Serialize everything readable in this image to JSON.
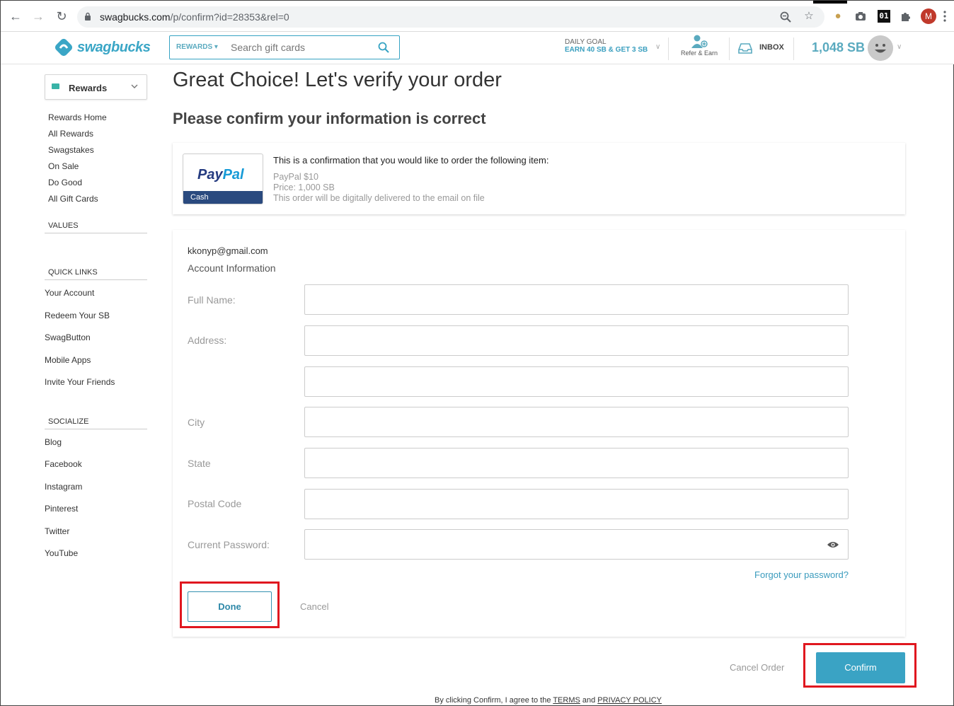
{
  "browser": {
    "url_host": "swagbucks.com",
    "url_path": "/p/confirm?id=28353&rel=0",
    "profile_initial": "M",
    "ext_label": "01",
    "icons": [
      "back-icon",
      "forward-icon",
      "reload-icon",
      "lock-icon",
      "zoom-icon",
      "star-icon",
      "cookie-icon",
      "camera-icon",
      "puzzle-icon",
      "more-icon"
    ]
  },
  "header": {
    "logo_text": "swagbucks",
    "search_category": "REWARDS",
    "search_placeholder": "Search gift cards",
    "daily_goal_title": "DAILY GOAL",
    "daily_goal_detail": "EARN 40 SB & GET 3 SB",
    "refer_label": "Refer & Earn",
    "inbox_label": "INBOX",
    "balance": "1,048 SB",
    "accent_color": "#3aa6c6"
  },
  "sidebar": {
    "select_label": "Rewards",
    "rewards_links": [
      "Rewards Home",
      "All Rewards",
      "Swagstakes",
      "On Sale",
      "Do Good",
      "All Gift Cards"
    ],
    "values_title": "VALUES",
    "quick_links_title": "QUICK LINKS",
    "quick_links": [
      "Your Account",
      "Redeem Your SB",
      "SwagButton",
      "Mobile Apps",
      "Invite Your Friends"
    ],
    "socialize_title": "SOCIALIZE",
    "social_links": [
      "Blog",
      "Facebook",
      "Instagram",
      "Pinterest",
      "Twitter",
      "YouTube"
    ]
  },
  "main": {
    "title": "Great Choice! Let's verify your order",
    "subtitle": "Please confirm your information is correct",
    "item": {
      "intro": "This is a confirmation that you would like to order the following item:",
      "name": "PayPal $10",
      "price": "Price: 1,000 SB",
      "delivery": "This order will be digitally delivered to the email on file",
      "thumb_brand_a": "Pay",
      "thumb_brand_b": "Pal",
      "thumb_caption": "Cash"
    },
    "form": {
      "email": "kkonyp@gmail.com",
      "section_title": "Account Information",
      "fields": [
        {
          "label": "Full Name:",
          "value": ""
        },
        {
          "label": "Address:",
          "value": ""
        },
        {
          "label": "",
          "value": ""
        },
        {
          "label": "City",
          "value": ""
        },
        {
          "label": "State",
          "value": ""
        },
        {
          "label": "Postal Code",
          "value": ""
        },
        {
          "label": "Current Password:",
          "value": ""
        }
      ],
      "forgot_password": "Forgot your password?",
      "done_label": "Done",
      "cancel_label": "Cancel"
    },
    "cancel_order_label": "Cancel Order",
    "confirm_label": "Confirm",
    "terms_prefix": "By clicking Confirm, I agree to the ",
    "terms_link": "TERMS",
    "terms_and": " and ",
    "privacy_link": "PRIVACY POLICY",
    "highlight_color": "#e0171f"
  }
}
